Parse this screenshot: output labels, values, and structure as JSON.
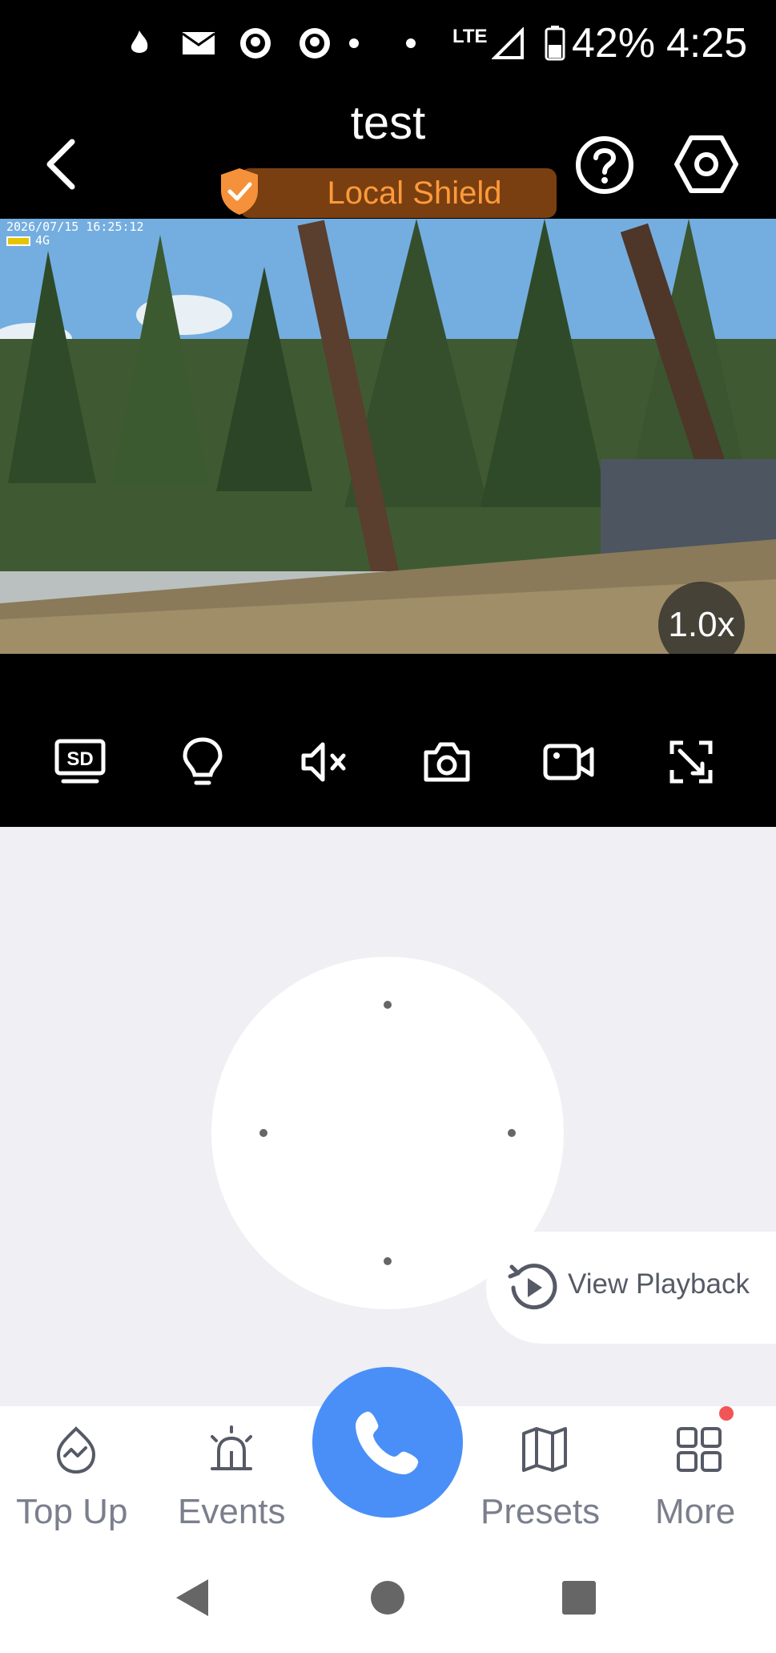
{
  "status_bar": {
    "battery": "42%",
    "time": "4:25",
    "network": "LTE",
    "icons": [
      "fire-icon",
      "mail-icon",
      "app-icon",
      "app-icon",
      "dot-icon",
      "dot-icon",
      "signal-icon",
      "battery-icon"
    ]
  },
  "header": {
    "title": "test",
    "badge": "Local Shield",
    "icons": [
      "back-icon",
      "help-icon",
      "settings-icon",
      "shield-check-icon"
    ]
  },
  "video": {
    "osd_datetime": "2026/07/15 16:25:12",
    "osd_signal": "4G",
    "zoom": "1.0x"
  },
  "toolbar": {
    "items": [
      {
        "name": "sd-quality-icon",
        "text": "SD"
      },
      {
        "name": "light-icon"
      },
      {
        "name": "mute-icon"
      },
      {
        "name": "snapshot-icon"
      },
      {
        "name": "record-icon"
      },
      {
        "name": "fullscreen-icon"
      }
    ]
  },
  "control": {
    "playback_label": "View Playback"
  },
  "bottom_nav": {
    "items": [
      {
        "label": "Top Up",
        "icon": "top-up-icon"
      },
      {
        "label": "Events",
        "icon": "events-icon"
      },
      {
        "label": "Presets",
        "icon": "presets-icon"
      },
      {
        "label": "More",
        "icon": "more-icon"
      }
    ],
    "call_icon": "phone-icon",
    "accent": "#4a8ff7"
  }
}
